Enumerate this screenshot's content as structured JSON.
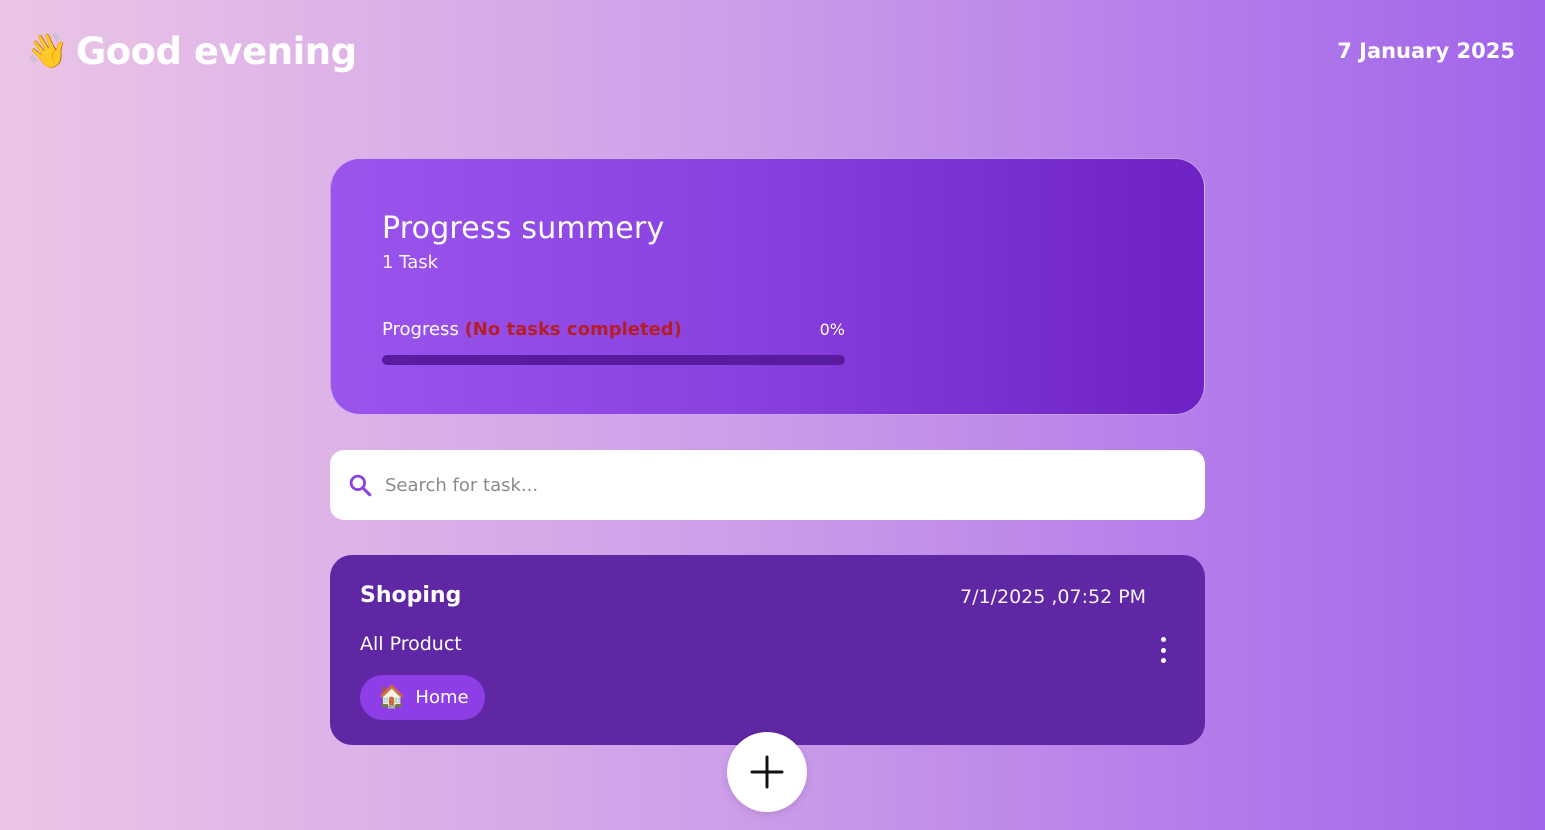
{
  "header": {
    "greeting_icon": "waving-hand-icon",
    "greeting": "Good evening",
    "date": "7 January 2025"
  },
  "summary": {
    "title": "Progress summery",
    "task_count": "1 Task",
    "progress_label": "Progress",
    "progress_note": "(No tasks completed)",
    "progress_percent_text": "0%",
    "progress_value": 0
  },
  "search": {
    "icon": "search-icon",
    "placeholder": "Search for task..."
  },
  "tasks": [
    {
      "title": "Shoping",
      "datetime": "7/1/2025 ,07:52 PM",
      "description": "All Product",
      "category_icon": "house-icon",
      "category": "Home"
    }
  ],
  "fab": {
    "icon": "plus-icon"
  },
  "colors": {
    "card_gradient_start": "#9b55ed",
    "card_gradient_end": "#6e21c4",
    "task_card": "#5f27a3",
    "chip": "#8d3ee6",
    "progress_track": "#5b1b9e",
    "warning_text": "#b51e25",
    "accent": "#8a42e0"
  }
}
